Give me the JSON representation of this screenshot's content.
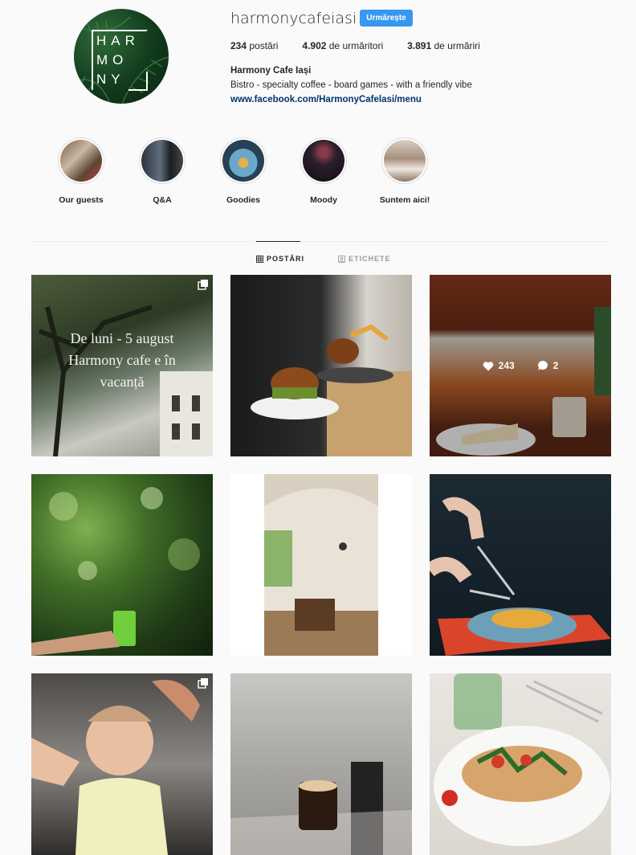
{
  "profile": {
    "username": "harmonycafeiasi",
    "follow_label": "Urmărește",
    "logo_lines": [
      "HAR",
      "MO",
      "NY"
    ],
    "stats": [
      {
        "value": "234",
        "label": " postări"
      },
      {
        "value": "4.902",
        "label": " de urmăritori"
      },
      {
        "value": "3.891",
        "label": " de urmăriri"
      }
    ],
    "full_name": "Harmony Cafe Iași",
    "bio": "Bistro - specialty coffee - board games - with a friendly vibe",
    "link": "www.facebook.com/HarmonyCafelasi/menu"
  },
  "highlights": [
    {
      "label": "Our guests"
    },
    {
      "label": "Q&A"
    },
    {
      "label": "Goodies"
    },
    {
      "label": "Moody"
    },
    {
      "label": "Suntem aici!"
    }
  ],
  "tabs": [
    {
      "label": "POSTĂRI",
      "icon": "grid-icon",
      "active": true
    },
    {
      "label": "ETICHETE",
      "icon": "tag-icon",
      "active": false
    }
  ],
  "posts": [
    {
      "description_text": "De luni - 5 august\nHarmony cafe e în\nvacanță",
      "multi": true
    },
    {
      "multi": false
    },
    {
      "multi": false,
      "likes": "243",
      "comments": "2",
      "hover": true
    },
    {
      "multi": false
    },
    {
      "multi": false
    },
    {
      "multi": false
    },
    {
      "multi": true
    },
    {
      "multi": false
    },
    {
      "multi": false
    }
  ],
  "colors": {
    "accent": "#3897f0",
    "link": "#003569",
    "background": "#fafafa"
  }
}
